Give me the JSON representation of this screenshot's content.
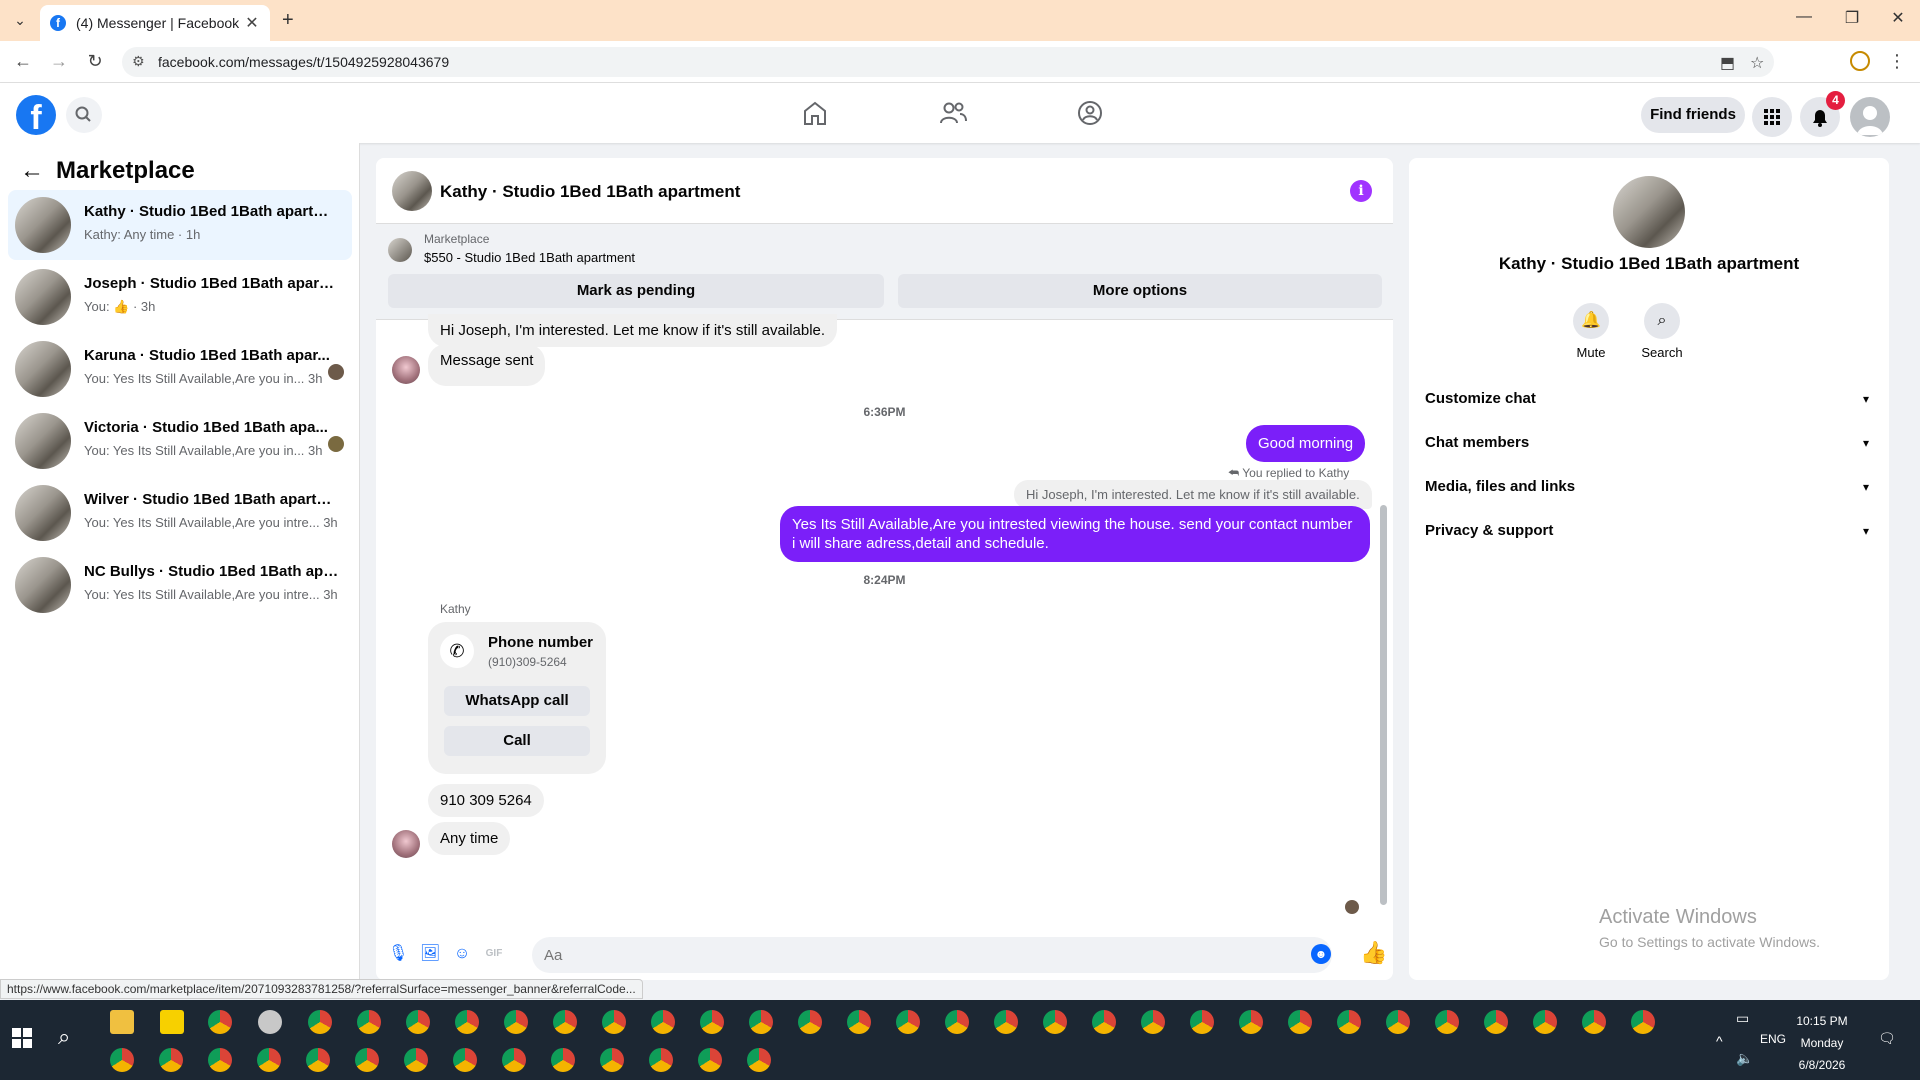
{
  "browser": {
    "tab_title": "(4) Messenger | Facebook",
    "url": "facebook.com/messages/t/1504925928043679",
    "status_url": "https://www.facebook.com/marketplace/item/2071093283781258/?referralSurface=messenger_banner&referralCode..."
  },
  "header": {
    "find_friends": "Find friends",
    "notification_count": "4",
    "logo_letter": "f"
  },
  "sidebar": {
    "title": "Marketplace",
    "conversations": [
      {
        "name": "Kathy · Studio 1Bed 1Bath apartment",
        "preview": "Kathy: Any time · 1h",
        "active": true
      },
      {
        "name": "Joseph · Studio 1Bed 1Bath apartm...",
        "preview": "You: 👍 · 3h",
        "active": false
      },
      {
        "name": "Karuna · Studio 1Bed 1Bath apar...",
        "preview": "You: Yes Its Still Available,Are you in... 3h",
        "active": false
      },
      {
        "name": "Victoria · Studio 1Bed 1Bath apa...",
        "preview": "You: Yes Its Still Available,Are you in... 3h",
        "active": false
      },
      {
        "name": "Wilver · Studio 1Bed 1Bath apartm...",
        "preview": "You: Yes Its Still Available,Are you intre... 3h",
        "active": false
      },
      {
        "name": "NC Bullys · Studio 1Bed 1Bath apar...",
        "preview": "You: Yes Its Still Available,Are you intre... 3h",
        "active": false
      }
    ]
  },
  "chat": {
    "title": "Kathy · Studio 1Bed 1Bath apartment",
    "marketplace_label": "Marketplace",
    "listing": "$550 - Studio 1Bed 1Bath apartment",
    "mark_pending": "Mark as pending",
    "more_options": "More options",
    "msg_interest": "Hi Joseph, I'm interested. Let me know if it's still available.",
    "msg_sent": "Message sent",
    "time1": "6:36PM",
    "msg_good_morning": "Good morning",
    "replied_note": "You replied to Kathy",
    "reply_quote": "Hi Joseph, I'm interested. Let me know if it's still available.",
    "msg_reply": "Yes Its Still Available,Are you intrested viewing the house. send your contact number i will share adress,detail and schedule.",
    "time2": "8:24PM",
    "sender": "Kathy",
    "card_title": "Phone number",
    "card_number": "(910)309-5264",
    "whatsapp_call": "WhatsApp call",
    "call": "Call",
    "msg_number": "910 309 5264",
    "msg_anytime": "Any time",
    "composer_placeholder": "Aa"
  },
  "details": {
    "name": "Kathy · Studio 1Bed 1Bath apartment",
    "mute": "Mute",
    "search": "Search",
    "sections": [
      "Customize chat",
      "Chat members",
      "Media, files and links",
      "Privacy & support"
    ],
    "watermark_title": "Activate Windows",
    "watermark_sub": "Go to Settings to activate Windows."
  },
  "taskbar": {
    "time": "10:15 PM",
    "day": "Monday",
    "date": "6/8/2026",
    "lang": "ENG"
  },
  "colors": {
    "brand": "#1877f2",
    "outgoing_bubble": "#7b1ff9",
    "badge": "#e41e3f"
  }
}
